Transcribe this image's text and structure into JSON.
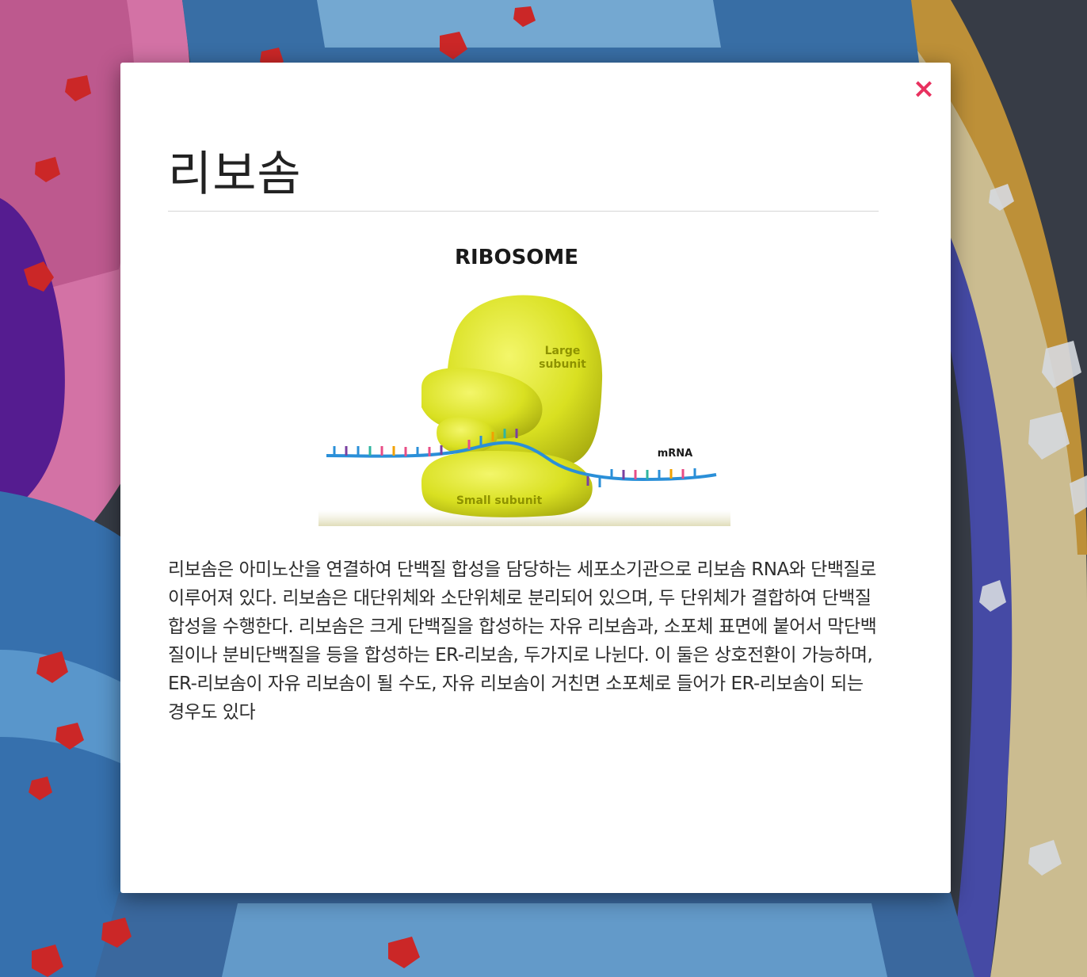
{
  "modal": {
    "close_label": "×",
    "title": "리보솜",
    "description": "리보솜은 아미노산을 연결하여 단백질 합성을 담당하는 세포소기관으로 리보솜 RNA와 단백질로 이루어져 있다. 리보솜은 대단위체와 소단위체로 분리되어 있으며, 두 단위체가 결합하여 단백질 합성을 수행한다. 리보솜은 크게 단백질을 합성하는 자유 리보솜과, 소포체 표면에 붙어서 막단백질이나 분비단백질을 등을 합성하는 ER-리보솜, 두가지로 나뉜다. 이 둘은 상호전환이 가능하며, ER-리보솜이 자유 리보솜이 될 수도, 자유 리보솜이 거친면 소포체로 들어가 ER-리보솜이 되는 경우도 있다"
  },
  "figure": {
    "heading": "RIBOSOME",
    "large_subunit_label_1": "Large",
    "large_subunit_label_2": "subunit",
    "small_subunit_label": "Small subunit",
    "mrna_label": "mRNA"
  },
  "colors": {
    "accent": "#e8315f",
    "ribosome_yellow": "#d9e021",
    "mrna_strand": "#2a8fd8"
  }
}
